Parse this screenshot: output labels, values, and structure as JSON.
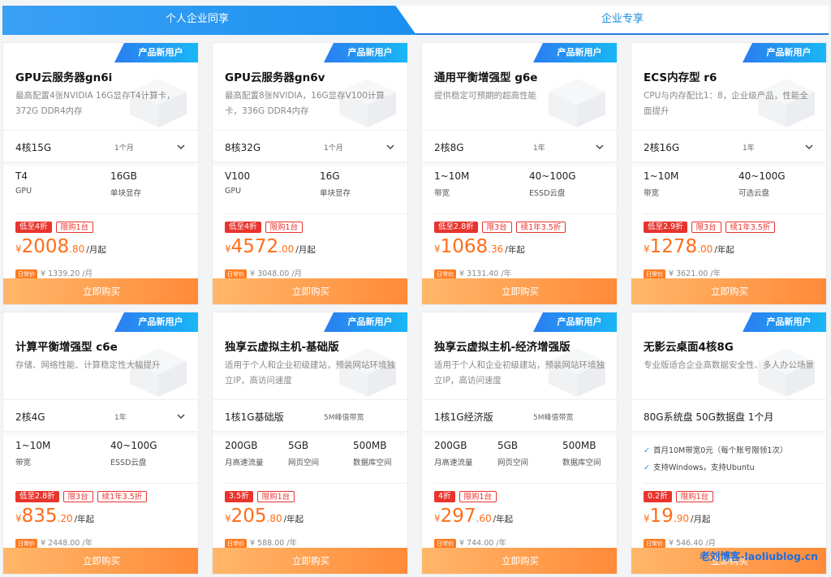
{
  "tabs": {
    "active": "个人企业同享",
    "other": "企业专享"
  },
  "new_badge": "产品新用户",
  "buy_label": "立即购买",
  "orig_tag": "日常价",
  "watermark": "老刘博客-laoliublog.cn",
  "cards": [
    {
      "title": "GPU云服务器gn6i",
      "desc": "最高配置4张NVIDIA 16G显存T4计算卡，372G DDR4内存",
      "sel": "4核15G",
      "dur": "1个月",
      "specs": [
        {
          "v": "T4",
          "l": "GPU"
        },
        {
          "v": "16GB",
          "l": "单块显存"
        }
      ],
      "tags": [
        "低至4折",
        "限购1台"
      ],
      "price_int": "2008",
      "price_dec": ".80",
      "unit": "/月起",
      "orig": "¥ 1339.20 /月"
    },
    {
      "title": "GPU云服务器gn6v",
      "desc": "最高配置8张NVIDIA，16G显存V100计算卡，336G DDR4内存",
      "sel": "8核32G",
      "dur": "1个月",
      "specs": [
        {
          "v": "V100",
          "l": "GPU"
        },
        {
          "v": "16G",
          "l": "单块显存"
        }
      ],
      "tags": [
        "低至4折",
        "限购1台"
      ],
      "price_int": "4572",
      "price_dec": ".00",
      "unit": "/月起",
      "orig": "¥ 3048.00 /月"
    },
    {
      "title": "通用平衡增强型 g6e",
      "desc": "提供稳定可预期的超高性能",
      "sel": "2核8G",
      "dur": "1年",
      "specs": [
        {
          "v": "1~10M",
          "l": "带宽"
        },
        {
          "v": "40~100G",
          "l": "ESSD云盘"
        }
      ],
      "tags": [
        "低至2.8折",
        "限3台",
        "续1年3.5折"
      ],
      "price_int": "1068",
      "price_dec": ".36",
      "unit": "/年起",
      "orig": "¥ 3131.40 /年"
    },
    {
      "title": "ECS内存型 r6",
      "desc": "CPU与内存配比1：8，企业级产品，性能全面提升",
      "sel": "2核16G",
      "dur": "1年",
      "specs": [
        {
          "v": "1~10M",
          "l": "带宽"
        },
        {
          "v": "40~100G",
          "l": "可选云盘"
        }
      ],
      "tags": [
        "低至2.9折",
        "限3台",
        "续1年3.5折"
      ],
      "price_int": "1278",
      "price_dec": ".00",
      "unit": "/年起",
      "orig": "¥ 3621.00 /年"
    },
    {
      "title": "计算平衡增强型 c6e",
      "desc": "存储、网络性能、计算稳定性大幅提升",
      "sel": "2核4G",
      "dur": "1年",
      "specs": [
        {
          "v": "1~10M",
          "l": "带宽"
        },
        {
          "v": "40~100G",
          "l": "ESSD云盘"
        }
      ],
      "tags": [
        "低至2.8折",
        "限3台",
        "续1年3.5折"
      ],
      "price_int": "835",
      "price_dec": ".20",
      "unit": "/年起",
      "orig": "¥ 2448.00 /年"
    },
    {
      "title": "独享云虚拟主机-基础版",
      "desc": "适用于个人和企业初级建站，预装网站环境独立IP，高访问速度",
      "sel": "1核1G基础版",
      "dur": "5M峰值带宽",
      "specs": [
        {
          "v": "200GB",
          "l": "月高速流量"
        },
        {
          "v": "5GB",
          "l": "网页空间"
        },
        {
          "v": "500MB",
          "l": "数据库空间"
        }
      ],
      "tags": [
        "3.5折",
        "限购1台"
      ],
      "price_int": "205",
      "price_dec": ".80",
      "unit": "/年起",
      "orig": "¥ 588.00 /年"
    },
    {
      "title": "独享云虚拟主机-经济增强版",
      "desc": "适用于个人和企业初级建站，预装网站环境独立IP，高访问速度",
      "sel": "1核1G经济版",
      "dur": "5M峰值带宽",
      "specs": [
        {
          "v": "200GB",
          "l": "月高速流量"
        },
        {
          "v": "5GB",
          "l": "网页空间"
        },
        {
          "v": "500MB",
          "l": "数据库空间"
        }
      ],
      "tags": [
        "4折",
        "限购1台"
      ],
      "price_int": "297",
      "price_dec": ".60",
      "unit": "/年起",
      "orig": "¥ 744.00 /年"
    },
    {
      "title": "无影云桌面4核8G",
      "desc": "专业版适合企业高数据安全性、多人办公场景",
      "sel": "80G系统盘 50G数据盘 1个月",
      "dur": "",
      "checks": [
        "首月10M带宽0元（每个账号限领1次）",
        "支持Windows，支持Ubuntu"
      ],
      "tags": [
        "0.2折",
        "限购1台"
      ],
      "price_int": "19",
      "price_dec": ".90",
      "unit": "/月起",
      "orig": "¥ 546.40 /月"
    }
  ]
}
